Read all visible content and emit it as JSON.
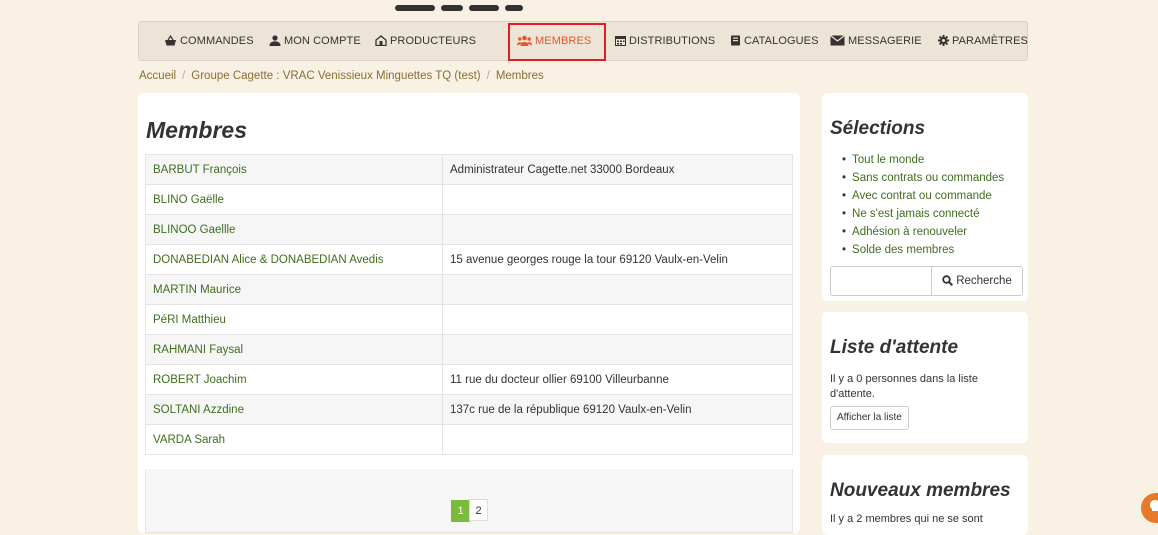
{
  "nav": {
    "items": [
      {
        "label": "COMMANDES",
        "icon": "shopping-basket-icon"
      },
      {
        "label": "MON COMPTE",
        "icon": "user-icon"
      },
      {
        "label": "PRODUCTEURS",
        "icon": "farm-icon"
      },
      {
        "label": "MEMBRES",
        "icon": "users-icon",
        "active": true
      },
      {
        "label": "DISTRIBUTIONS",
        "icon": "calendar-icon"
      },
      {
        "label": "CATALOGUES",
        "icon": "book-icon"
      },
      {
        "label": "MESSAGERIE",
        "icon": "envelope-icon"
      },
      {
        "label": "PARAMÈTRES",
        "icon": "gear-icon"
      }
    ]
  },
  "breadcrumb": {
    "home": "Accueil",
    "group": "Groupe Cagette : VRAC Venissieux Minguettes TQ (test)",
    "current": "Membres"
  },
  "members": {
    "title": "Membres",
    "rows": [
      {
        "name": "BARBUT François",
        "address": "Administrateur Cagette.net 33000 Bordeaux"
      },
      {
        "name": "BLINO Gaëlle",
        "address": ""
      },
      {
        "name": "BLINOO Gaellle",
        "address": ""
      },
      {
        "name": "DONABEDIAN Alice & DONABEDIAN Avedis",
        "address": "15 avenue georges rouge la tour 69120 Vaulx-en-Velin"
      },
      {
        "name": "MARTIN Maurice",
        "address": ""
      },
      {
        "name": "PéRI Matthieu",
        "address": ""
      },
      {
        "name": "RAHMANI Faysal",
        "address": ""
      },
      {
        "name": "ROBERT Joachim",
        "address": "11 rue du docteur ollier 69100 Villeurbanne"
      },
      {
        "name": "SOLTANI Azzdine",
        "address": "137c rue de la république 69120 Vaulx-en-Velin"
      },
      {
        "name": "VARDA Sarah",
        "address": ""
      }
    ],
    "pagination": {
      "pages": [
        "1",
        "2"
      ],
      "current": "1"
    }
  },
  "selections": {
    "title": "Sélections",
    "items": [
      "Tout le monde",
      "Sans contrats ou commandes",
      "Avec contrat ou commande",
      "Ne s'est jamais connecté",
      "Adhésion à renouveler",
      "Solde des membres"
    ],
    "search_button": "Recherche"
  },
  "waitlist": {
    "title": "Liste d'attente",
    "text": "Il y a 0 personnes dans la liste d'attente.",
    "button": "Afficher la liste"
  },
  "new_members": {
    "title": "Nouveaux membres",
    "text": "Il y a 2 membres qui ne se sont"
  },
  "colors": {
    "background": "#f8f1e4",
    "link_green": "#3f6e1e",
    "active_nav": "#e4572e",
    "highlight_box": "#e31b23",
    "pager_active": "#7cba3d",
    "help_badge": "#e8792b"
  }
}
